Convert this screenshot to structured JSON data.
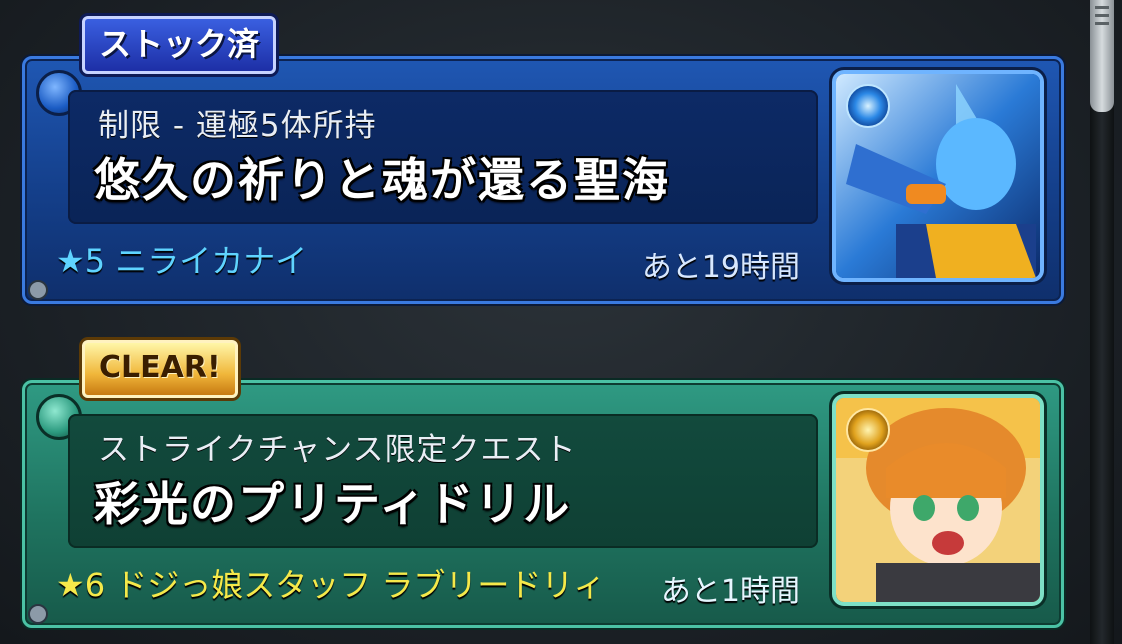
{
  "cards": [
    {
      "badge": "ストック済",
      "subtitle": "制限 - 運極5体所持",
      "title": "悠久の祈りと魂が還る聖海",
      "monster": "★5 ニライカナイ",
      "time_left": "あと19時間",
      "theme": "blue",
      "element_icon": "water-element-icon"
    },
    {
      "badge": "CLEAR!",
      "subtitle": "ストライクチャンス限定クエスト",
      "title": "彩光のプリティドリル",
      "monster": "★6 ドジっ娘スタッフ ラブリードリィ",
      "time_left": "あと1時間",
      "theme": "green",
      "element_icon": "light-element-icon"
    }
  ],
  "colors": {
    "blue_frame": "#1f57b3",
    "green_frame": "#2f9a83",
    "blue_monster_text": "#5fd4ff",
    "green_monster_text": "#f5e94a"
  }
}
